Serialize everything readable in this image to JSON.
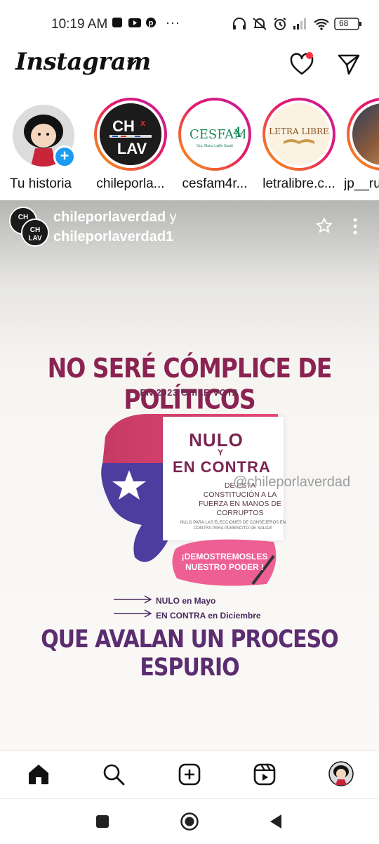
{
  "status_bar": {
    "time": "10:19 AM",
    "battery": "68",
    "icons": [
      "app-notification-icon",
      "youtube-icon",
      "pinterest-icon",
      "more-icon",
      "headphones-icon",
      "mute-icon",
      "alarm-icon",
      "signal-icon",
      "wifi-icon",
      "battery-icon"
    ]
  },
  "header": {
    "logo": "Instagram",
    "icons": [
      "chevron-down-icon",
      "heart-icon",
      "send-icon"
    ],
    "notification_dot_color": "#ff3040"
  },
  "stories": [
    {
      "label": "Tu historia"
    },
    {
      "label": "chileporla..."
    },
    {
      "label": "cesfam4r..."
    },
    {
      "label": "letralibre.c..."
    },
    {
      "label": "jp__ru"
    }
  ],
  "post": {
    "author1": "chileporlaverdad",
    "joiner": "y",
    "author2": "chileporlaverdad1",
    "image": {
      "title": "NO SERÉ CÓMPLICE DE POLÍTICOS",
      "subtitle": "EN 2023 CHILE VOTA",
      "nulo": "NULO",
      "y": "Y",
      "en_contra": "EN CONTRA",
      "description": "DE ESTA CONSTITUCIÓN A LA FUERZA EN MANOS DE CORRUPTOS",
      "fine_print": "NULO PARA LAS ELECCIONES DE CONSEJEROS EN CONTRA PARA PLEBISCITO DE SALIDA",
      "poder": "¡DEMOSTREMOSLES NUESTRO PODER !",
      "line1": "NULO en Mayo",
      "line2": "EN CONTRA en Diciembre",
      "bottom": "QUE AVALAN UN PROCESO ESPURIO",
      "watermark": "@chileporlaverdad",
      "logo_top": "CH",
      "logo_x": "x",
      "logo_bottom": "LAV",
      "cesfam_logo": "CESFAM",
      "cesfam_num": "4",
      "cesfam_doc": "Dra. María Latife Saadi",
      "letralibre_logo": "LETRA LIBRE"
    }
  },
  "bottom_nav": {
    "icons": [
      "home-icon",
      "search-icon",
      "create-icon",
      "reels-icon",
      "profile-avatar"
    ]
  },
  "system_nav": {
    "icons": [
      "recents-icon",
      "home-circle-icon",
      "back-icon"
    ]
  },
  "colors": {
    "title": "#8a2352",
    "bottom_text": "#5b2c6f",
    "story_ring_start": "#f9a20a",
    "story_ring_end": "#c21fa3",
    "plus_badge": "#1d9bf0"
  }
}
